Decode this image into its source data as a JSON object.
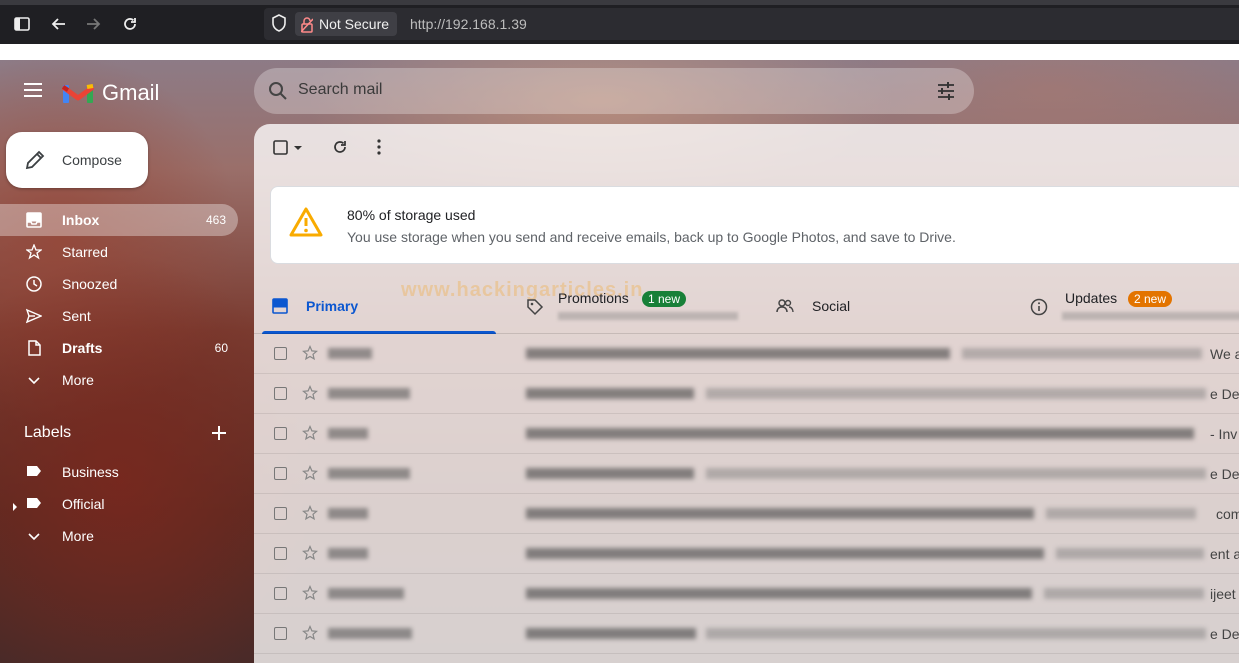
{
  "browser": {
    "security_label": "Not Secure",
    "url": "http://192.168.1.39"
  },
  "app": {
    "name": "Gmail",
    "search_placeholder": "Search mail",
    "compose_label": "Compose"
  },
  "nav": {
    "items": [
      {
        "label": "Inbox",
        "count": "463",
        "icon": "inbox-icon"
      },
      {
        "label": "Starred",
        "count": "",
        "icon": "star-icon"
      },
      {
        "label": "Snoozed",
        "count": "",
        "icon": "clock-icon"
      },
      {
        "label": "Sent",
        "count": "",
        "icon": "send-icon"
      },
      {
        "label": "Drafts",
        "count": "60",
        "icon": "draft-icon"
      },
      {
        "label": "More",
        "count": "",
        "icon": "chevron-down-icon"
      }
    ]
  },
  "labels": {
    "heading": "Labels",
    "items": [
      {
        "label": "Business"
      },
      {
        "label": "Official"
      },
      {
        "label": "More"
      }
    ]
  },
  "storage": {
    "title": "80% of storage used",
    "message": "You use storage when you send and receive emails, back up to Google Photos, and save to Drive."
  },
  "tabs": [
    {
      "label": "Primary",
      "badge": ""
    },
    {
      "label": "Promotions",
      "badge": "1 new",
      "badge_color": "#188038"
    },
    {
      "label": "Social",
      "badge": ""
    },
    {
      "label": "Updates",
      "badge": "2 new",
      "badge_color": "#e37400"
    }
  ],
  "emails": [
    {
      "tail": "We a"
    },
    {
      "tail": "e Dea"
    },
    {
      "tail": "- Inv"
    },
    {
      "tail": "e Dea"
    },
    {
      "tail": "com"
    },
    {
      "tail": "ent a"
    },
    {
      "tail": "ijeet"
    },
    {
      "tail": "e Dea"
    }
  ],
  "watermark": "www.hackingarticles.in",
  "colors": {
    "accent": "#0b57d0",
    "warning": "#f9ab00"
  }
}
